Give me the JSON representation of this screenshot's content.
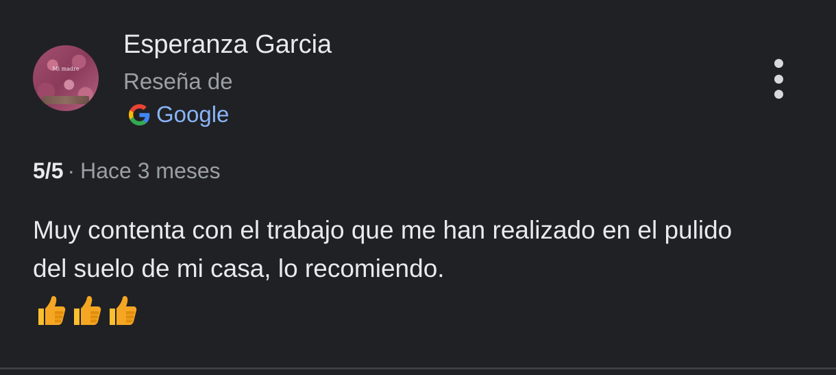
{
  "review": {
    "author": "Esperanza Garcia",
    "avatar_caption": "Mi madre",
    "source_label": "Reseña de",
    "source_name": "Google",
    "rating": "5/5",
    "separator": "·",
    "time_ago": "Hace 3 meses",
    "text": "Muy contenta con el trabajo que me han realizado en el pulido del suelo de mi casa, lo recomiendo.",
    "emoji": [
      "thumbs-up",
      "thumbs-up",
      "thumbs-up"
    ]
  },
  "icons": {
    "source_logo": "google-g-icon",
    "menu": "more-vert-icon"
  },
  "colors": {
    "background": "#202124",
    "primary_text": "#e8eaed",
    "secondary_text": "#9aa0a6",
    "link": "#8ab4f8",
    "emoji": "#fbbf2f"
  }
}
